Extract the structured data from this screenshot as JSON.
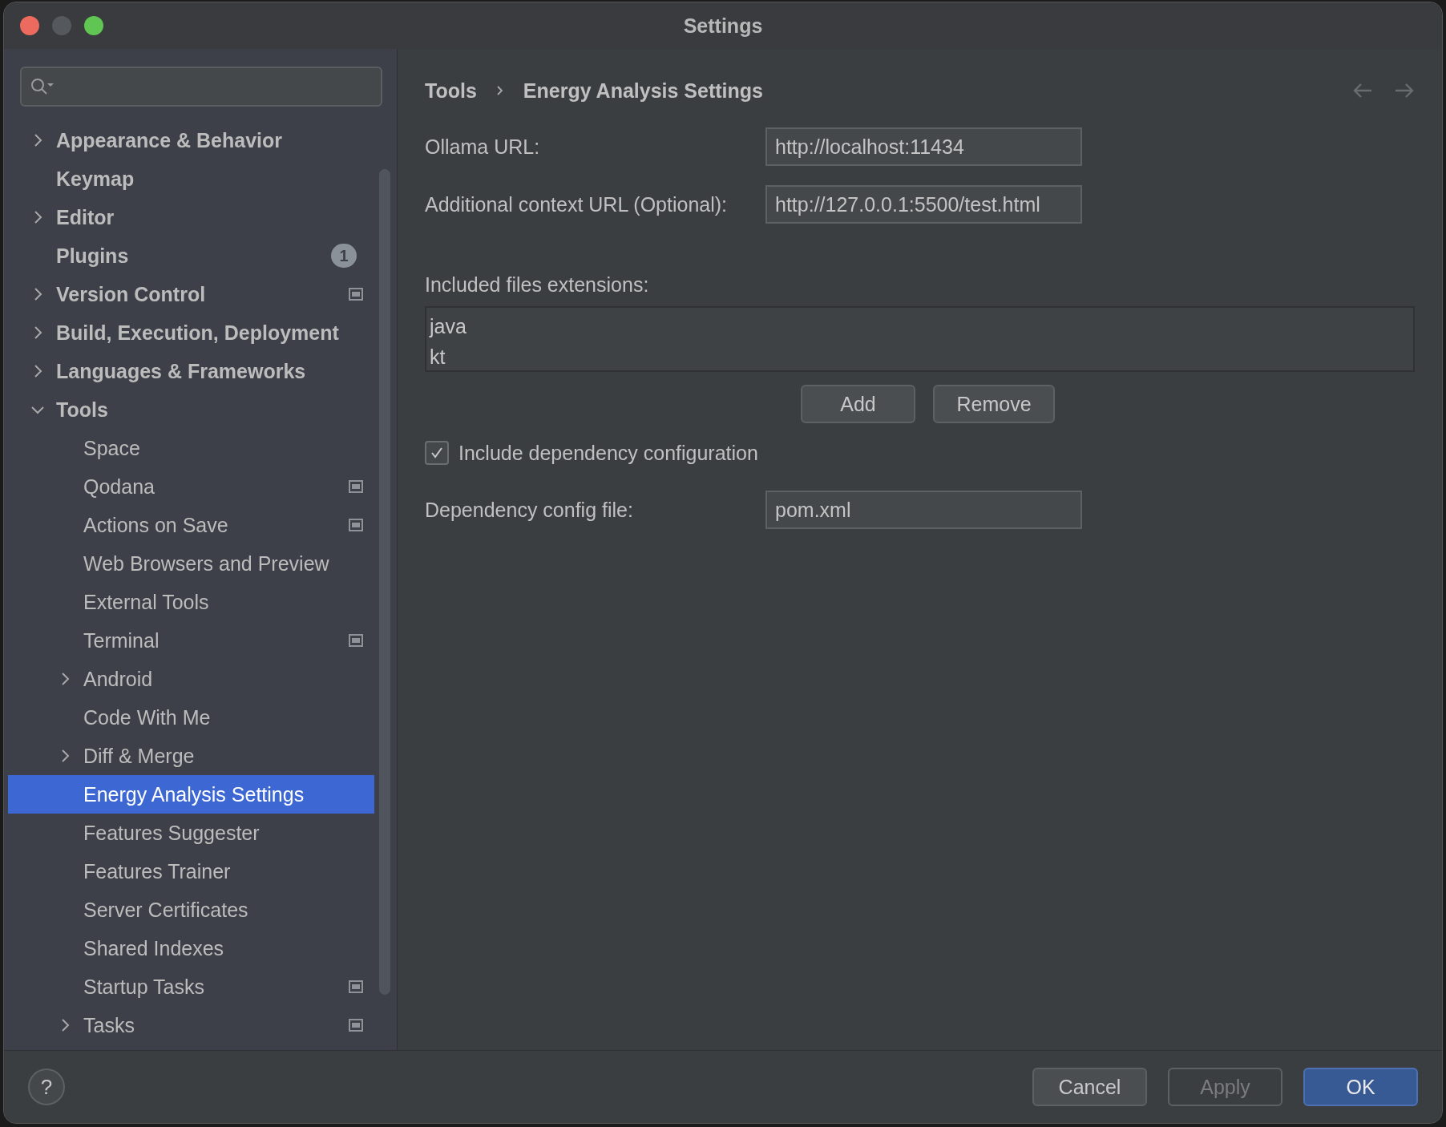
{
  "window": {
    "title": "Settings"
  },
  "sidebar": {
    "items": [
      {
        "label": "Appearance & Behavior",
        "selected": false,
        "expanded": false
      },
      {
        "label": "Keymap",
        "selected": false
      },
      {
        "label": "Editor",
        "selected": false,
        "expanded": false
      },
      {
        "label": "Plugins",
        "selected": false,
        "badge": "1"
      },
      {
        "label": "Version Control",
        "selected": false,
        "expanded": false,
        "project_scope": true
      },
      {
        "label": "Build, Execution, Deployment",
        "selected": false,
        "expanded": false
      },
      {
        "label": "Languages & Frameworks",
        "selected": false,
        "expanded": false
      },
      {
        "label": "Tools",
        "selected": false,
        "expanded": true,
        "children": [
          {
            "label": "Space",
            "selected": false
          },
          {
            "label": "Qodana",
            "selected": false,
            "project_scope": true
          },
          {
            "label": "Actions on Save",
            "selected": false,
            "project_scope": true
          },
          {
            "label": "Web Browsers and Preview",
            "selected": false
          },
          {
            "label": "External Tools",
            "selected": false
          },
          {
            "label": "Terminal",
            "selected": false,
            "project_scope": true
          },
          {
            "label": "Android",
            "selected": false,
            "expanded": false
          },
          {
            "label": "Code With Me",
            "selected": false
          },
          {
            "label": "Diff & Merge",
            "selected": false,
            "expanded": false
          },
          {
            "label": "Energy Analysis Settings",
            "selected": true
          },
          {
            "label": "Features Suggester",
            "selected": false
          },
          {
            "label": "Features Trainer",
            "selected": false
          },
          {
            "label": "Server Certificates",
            "selected": false
          },
          {
            "label": "Shared Indexes",
            "selected": false
          },
          {
            "label": "Startup Tasks",
            "selected": false,
            "project_scope": true
          },
          {
            "label": "Tasks",
            "selected": false,
            "expanded": false,
            "project_scope": true
          }
        ]
      }
    ]
  },
  "breadcrumb": [
    "Tools",
    "Energy Analysis Settings"
  ],
  "fields": [
    {
      "label": "Ollama URL:",
      "value": "http://localhost:11434"
    },
    {
      "label": "Additional context URL (Optional):",
      "value": "http://127.0.0.1:5500/test.html"
    }
  ],
  "extensions": {
    "label": "Included files extensions:",
    "items": [
      "java",
      "kt"
    ]
  },
  "list_buttons": [
    "Add",
    "Remove"
  ],
  "dependency_checkbox": {
    "label": "Include dependency configuration",
    "checked": true
  },
  "dependency_file": {
    "label": "Dependency config file:",
    "value": "pom.xml"
  },
  "footer": {
    "help": "?",
    "buttons": [
      {
        "label": "Cancel",
        "kind": "normal"
      },
      {
        "label": "Apply",
        "kind": "disabled"
      },
      {
        "label": "OK",
        "kind": "default"
      }
    ]
  }
}
